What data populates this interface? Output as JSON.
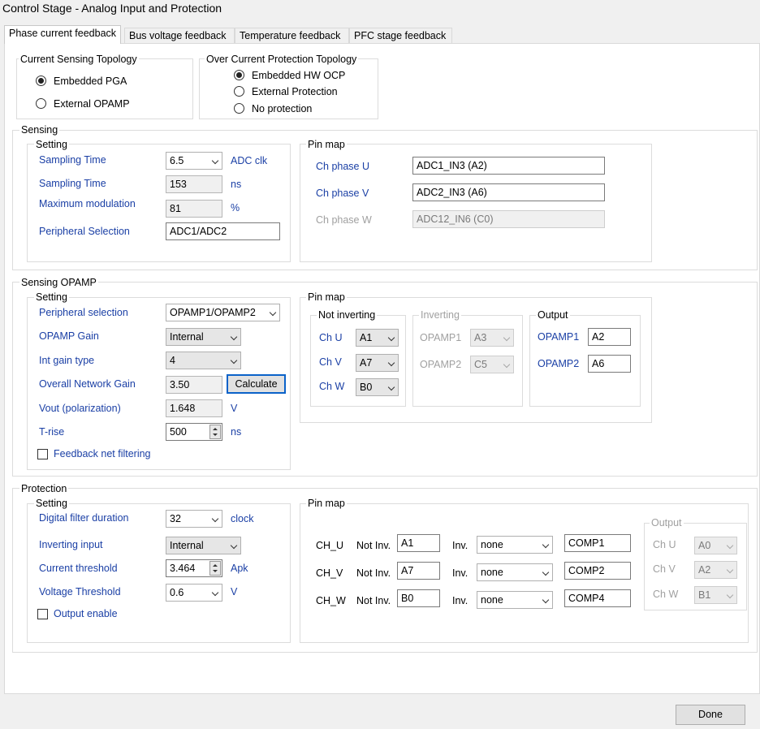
{
  "window": {
    "title": "Control Stage - Analog Input and Protection"
  },
  "tabs": [
    "Phase current feedback",
    "Bus voltage feedback",
    "Temperature feedback",
    "PFC stage feedback"
  ],
  "topology": {
    "current_label": "Current Sensing Topology",
    "current_options": [
      "Embedded PGA",
      "External OPAMP"
    ],
    "ocp_label": "Over Current Protection Topology",
    "ocp_options": [
      "Embedded HW OCP",
      "External Protection",
      "No protection"
    ]
  },
  "sensing": {
    "label": "Sensing",
    "setting_label": "Setting",
    "sampling_time_label": "Sampling Time",
    "sampling_time_value": "6.5",
    "sampling_time_unit": "ADC clk",
    "sampling_time2_label": "Sampling Time",
    "sampling_time2_value": "153",
    "sampling_time2_unit": "ns",
    "max_mod_label": "Maximum modulation",
    "max_mod_value": "81",
    "max_mod_unit": "%",
    "peripheral_label": "Peripheral Selection",
    "peripheral_value": "ADC1/ADC2",
    "pinmap_label": "Pin map",
    "ch_u_label": "Ch phase U",
    "ch_u_value": "ADC1_IN3 (A2)",
    "ch_v_label": "Ch phase V",
    "ch_v_value": "ADC2_IN3 (A6)",
    "ch_w_label": "Ch phase W",
    "ch_w_value": "ADC12_IN6 (C0)"
  },
  "opamp": {
    "label": "Sensing OPAMP",
    "setting_label": "Setting",
    "peripheral_label": "Peripheral selection",
    "peripheral_value": "OPAMP1/OPAMP2",
    "gain_label": "OPAMP Gain",
    "gain_value": "Internal",
    "int_gain_label": "Int gain type",
    "int_gain_value": "4",
    "network_gain_label": "Overall Network Gain",
    "network_gain_value": "3.50",
    "calculate_label": "Calculate",
    "vout_label": "Vout (polarization)",
    "vout_value": "1.648",
    "vout_unit": "V",
    "trise_label": "T-rise",
    "trise_value": "500",
    "trise_unit": "ns",
    "filter_label": "Feedback net filtering",
    "pinmap_label": "Pin map",
    "not_inverting_label": "Not inverting",
    "ni_u_label": "Ch U",
    "ni_u_value": "A1",
    "ni_v_label": "Ch V",
    "ni_v_value": "A7",
    "ni_w_label": "Ch W",
    "ni_w_value": "B0",
    "inverting_label": "Inverting",
    "inv1_label": "OPAMP1",
    "inv1_value": "A3",
    "inv2_label": "OPAMP2",
    "inv2_value": "C5",
    "output_label": "Output",
    "out1_label": "OPAMP1",
    "out1_value": "A2",
    "out2_label": "OPAMP2",
    "out2_value": "A6"
  },
  "protection": {
    "label": "Protection",
    "setting_label": "Setting",
    "filter_label": "Digital filter duration",
    "filter_value": "32",
    "filter_unit": "clock",
    "inv_input_label": "Inverting input",
    "inv_input_value": "Internal",
    "threshold_label": "Current threshold",
    "threshold_value": "3.464",
    "threshold_unit": "Apk",
    "vthreshold_label": "Voltage Threshold",
    "vthreshold_value": "0.6",
    "vthreshold_unit": "V",
    "output_enable_label": "Output enable",
    "pinmap_label": "Pin map",
    "not_inv_label": "Not Inv.",
    "inv_label": "Inv.",
    "rows": [
      {
        "ch": "CH_U",
        "not_inv": "A1",
        "inv": "none",
        "comp": "COMP1"
      },
      {
        "ch": "CH_V",
        "not_inv": "A7",
        "inv": "none",
        "comp": "COMP2"
      },
      {
        "ch": "CH_W",
        "not_inv": "B0",
        "inv": "none",
        "comp": "COMP4"
      }
    ],
    "output_label": "Output",
    "outputs": [
      {
        "ch": "Ch U",
        "value": "A0"
      },
      {
        "ch": "Ch V",
        "value": "A2"
      },
      {
        "ch": "Ch W",
        "value": "B1"
      }
    ]
  },
  "footer": {
    "done_label": "Done"
  },
  "colors": {
    "label_blue": "#1a3fa5",
    "focus_blue": "#0a62c9",
    "disabled_grey": "#a0a0a0"
  }
}
